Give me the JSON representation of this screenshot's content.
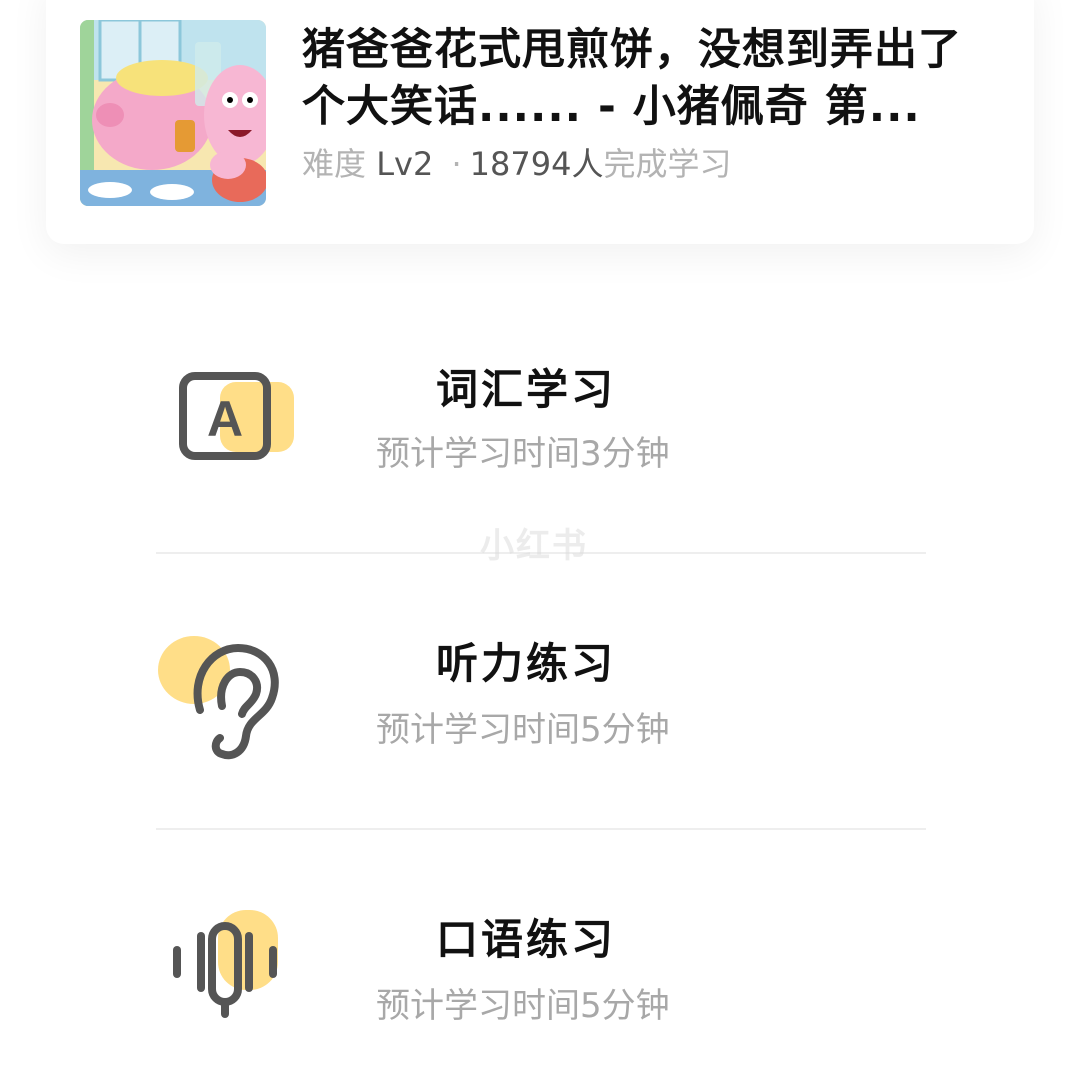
{
  "lesson": {
    "title": "猪爸爸花式甩煎饼，没想到弄出了个大笑话...... - 小猪佩奇 第...",
    "difficulty_label": "难度",
    "difficulty_value": "Lv2",
    "separator": "·",
    "learners_count": "18794人",
    "learners_suffix": "完成学习"
  },
  "exercises": [
    {
      "title": "词汇学习",
      "subtitle": "预计学习时间3分钟",
      "icon": "vocabulary-a-icon"
    },
    {
      "title": "听力练习",
      "subtitle": "预计学习时间5分钟",
      "icon": "ear-icon"
    },
    {
      "title": "口语练习",
      "subtitle": "预计学习时间5分钟",
      "icon": "microphone-wave-icon"
    }
  ],
  "watermark": "小红书",
  "colors": {
    "accent_yellow": "#FFD873",
    "icon_gray": "#555555",
    "title_black": "#111111",
    "subtitle_gray": "#A8A8A8"
  }
}
